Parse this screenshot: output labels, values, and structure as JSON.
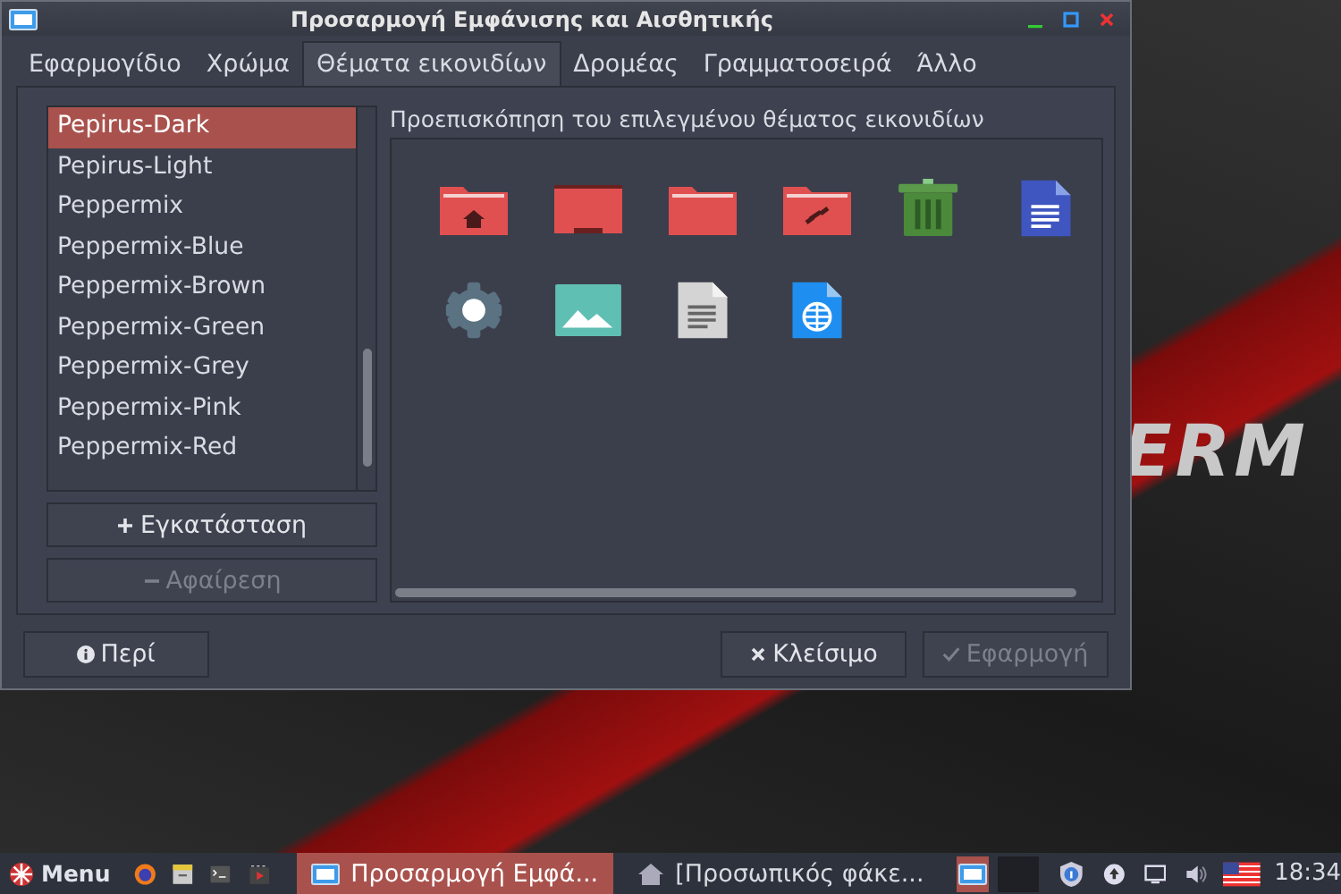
{
  "window": {
    "title": "Προσαρμογή Εμφάνισης και Αισθητικής"
  },
  "tabs": [
    {
      "label": "Εφαρμογίδιο",
      "selected": false
    },
    {
      "label": "Χρώμα",
      "selected": false
    },
    {
      "label": "Θέματα εικονιδίων",
      "selected": true
    },
    {
      "label": "Δρομέας",
      "selected": false
    },
    {
      "label": "Γραμματοσειρά",
      "selected": false
    },
    {
      "label": "Άλλο",
      "selected": false
    }
  ],
  "themes": [
    {
      "name": "Pepirus-Dark",
      "selected": true
    },
    {
      "name": "Pepirus-Light",
      "selected": false
    },
    {
      "name": "Peppermix",
      "selected": false
    },
    {
      "name": "Peppermix-Blue",
      "selected": false
    },
    {
      "name": "Peppermix-Brown",
      "selected": false
    },
    {
      "name": "Peppermix-Green",
      "selected": false
    },
    {
      "name": "Peppermix-Grey",
      "selected": false
    },
    {
      "name": "Peppermix-Pink",
      "selected": false
    },
    {
      "name": "Peppermix-Red",
      "selected": false
    }
  ],
  "theme_buttons": [
    {
      "label": "Εγκατάσταση",
      "kind": "add",
      "disabled": false
    },
    {
      "label": "Αφαίρεση",
      "kind": "remove",
      "disabled": true
    }
  ],
  "preview": {
    "label": "Προεπισκόπηση του επιλεγμένου θέματος εικονιδίων",
    "icons": [
      {
        "kind": "folder-home"
      },
      {
        "kind": "folder-desktop"
      },
      {
        "kind": "folder"
      },
      {
        "kind": "folder-share"
      },
      {
        "kind": "trash"
      },
      {
        "kind": "document"
      },
      {
        "kind": "gear"
      },
      {
        "kind": "image"
      },
      {
        "kind": "text-file"
      },
      {
        "kind": "web-file"
      }
    ]
  },
  "footer_buttons": [
    {
      "label": "Περί",
      "kind": "info",
      "disabled": false
    },
    {
      "label": "Κλείσιμο",
      "kind": "close",
      "disabled": false
    },
    {
      "label": "Εφαρμογή",
      "kind": "apply",
      "disabled": true
    }
  ],
  "wallpaper_text": "ERM",
  "taskbar": {
    "menu": "Menu",
    "launchers": [
      {
        "kind": "browser"
      },
      {
        "kind": "files"
      },
      {
        "kind": "terminal"
      },
      {
        "kind": "media"
      }
    ],
    "tasks": [
      {
        "label": "Προσαρμογή Εμφά...",
        "kind": "window",
        "selected": true
      },
      {
        "label": "[Προσωπικός φάκε...",
        "kind": "home",
        "selected": false
      }
    ],
    "tray": [
      {
        "kind": "pager"
      },
      {
        "kind": "blank"
      },
      {
        "kind": "shield"
      },
      {
        "kind": "update"
      },
      {
        "kind": "display"
      },
      {
        "kind": "volume"
      },
      {
        "kind": "flag"
      }
    ],
    "clock": "18:34"
  }
}
